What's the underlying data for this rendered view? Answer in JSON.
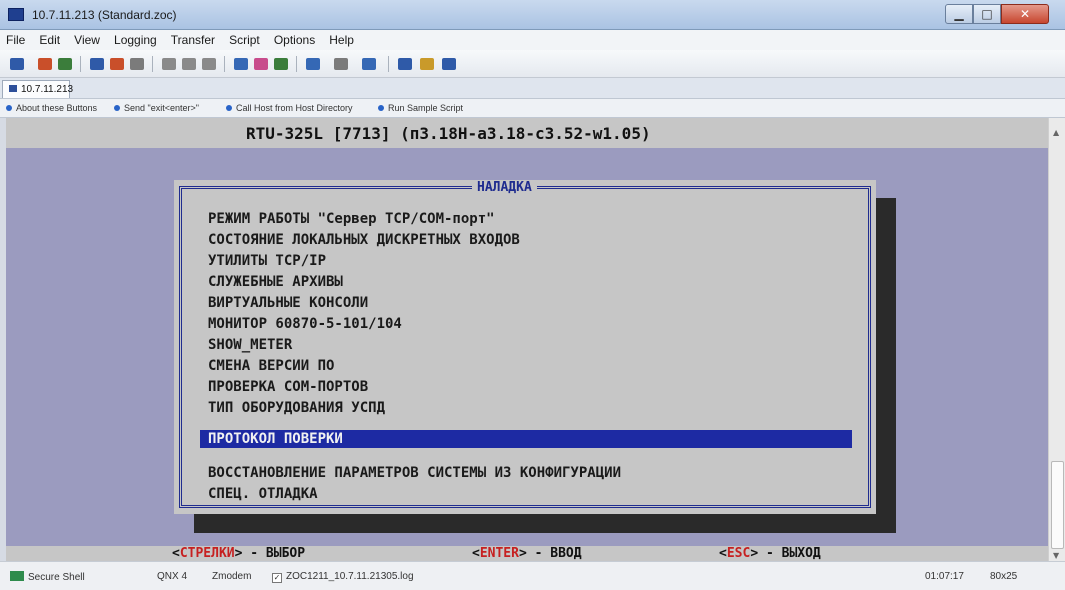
{
  "window": {
    "title": "10.7.11.213 (Standard.zoc)",
    "minimize": "▁",
    "maximize": "□",
    "close": "✕"
  },
  "menubar": {
    "items": [
      "File",
      "Edit",
      "View",
      "Logging",
      "Transfer",
      "Script",
      "Options",
      "Help"
    ]
  },
  "toolbar": {
    "icon_colors": [
      "#2f5aa8",
      "#c94f2a",
      "#3b7d3b",
      "#2f5aa8",
      "#c94f2a",
      "#7b7b7b",
      "#8a8a8a",
      "#8a8a8a",
      "#8a8a8a",
      "#3568b5",
      "#c84c8c",
      "#3b7d3b",
      "#3568b5",
      "#7b7b7b",
      "#3568b5",
      "#2f5aa8",
      "#c99a2a",
      "#2f5aa8",
      "#2f5aa8",
      "#8a6fb3",
      "#3b7d3b",
      "#2f5aa8",
      "#c99a2a"
    ]
  },
  "session_tab": {
    "label": "10.7.11.213"
  },
  "button_bar": {
    "buttons": [
      "About these Buttons",
      "Send \"exit<enter>\"",
      "Call Host from Host Directory",
      "Run Sample Script"
    ]
  },
  "terminal": {
    "header": "RTU-325L [7713]   (п3.18H-a3.18-c3.52-w1.05)",
    "dialog_title": "НАЛАДКА",
    "menu_items": [
      "РЕЖИМ РАБОТЫ \"Сервер TCP/COM-порт\"",
      "СОСТОЯНИЕ ЛОКАЛЬНЫХ ДИСКРЕТНЫХ ВХОДОВ",
      "УТИЛИТЫ TCP/IP",
      "СЛУЖЕБНЫЕ АРХИВЫ",
      "ВИРТУАЛЬНЫЕ КОНСОЛИ",
      "МОНИТОР 60870-5-101/104",
      "SHOW_METER",
      "СМЕНА ВЕРСИИ ПО",
      "ПРОВЕРКА COM-ПОРТОВ",
      "ТИП ОБОРУДОВАНИЯ УСПД"
    ],
    "selected_item": "ПРОТОКОЛ ПОВЕРКИ",
    "bottom_items": [
      "ВОССТАНОВЛЕНИЕ ПАРАМЕТРОВ СИСТЕМЫ ИЗ КОНФИГУРАЦИИ",
      "СПЕЦ. ОТЛАДКА"
    ],
    "footer": {
      "arrows_key": "СТРЕЛКИ",
      "arrows_action": "> - ВЫБОР",
      "enter_key": "ENTER",
      "enter_action": "> - ВВОД",
      "esc_key": "ESC",
      "esc_action": "> - ВЫХОД",
      "open_bracket": "<"
    }
  },
  "statusbar": {
    "connection": "Secure Shell",
    "emulation": "QNX 4",
    "transfer": "Zmodem",
    "log_checked": "✓",
    "log_file": "ZOC1211_10.7.11.21305.log",
    "time": "01:07:17",
    "size": "80x25"
  },
  "colors": {
    "terminal_bg": "#9b9bbf",
    "dialog_bg": "#c6c6c6",
    "frame": "#1f2c8f",
    "selection": "#1d2aa3",
    "key_red": "#c62020"
  }
}
